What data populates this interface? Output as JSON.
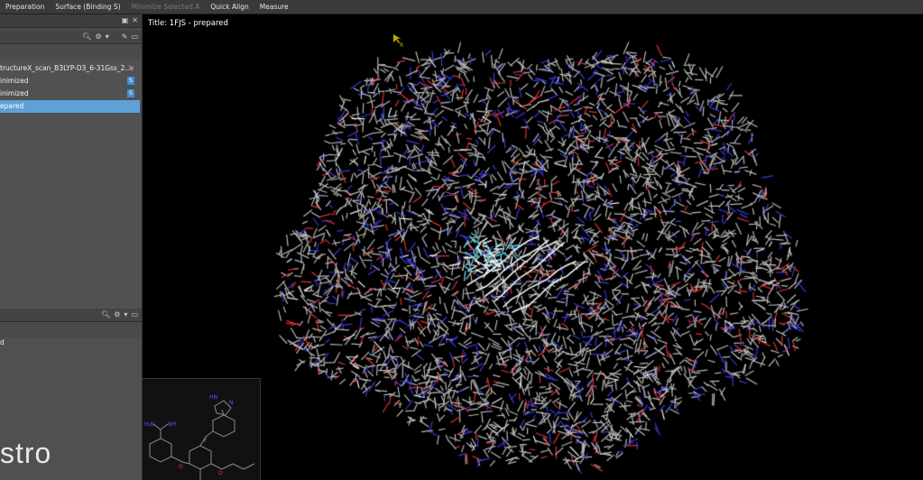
{
  "toolbar": {
    "items": [
      {
        "label": "Preparation",
        "enabled": true
      },
      {
        "label": "Surface (Binding S)",
        "enabled": true
      },
      {
        "label": "Minimize Selected A",
        "enabled": false
      },
      {
        "label": "Quick Align",
        "enabled": true
      },
      {
        "label": "Measure",
        "enabled": true
      }
    ]
  },
  "entries": {
    "row0": "tructureX_scan_B3LYP-D3_6-31Gss_2....",
    "row1": "inimized",
    "row2": "inimized",
    "row3": "epared",
    "badge1": "S",
    "badge2": "S"
  },
  "lower_panel": {
    "text": "d"
  },
  "watermark": "stro",
  "viewport": {
    "title": "Title: 1FJS - prepared"
  },
  "colors": {
    "carbon": "#b8b8b8",
    "nitrogen": "#3a3ae0",
    "oxygen": "#e03030",
    "highlight": "#5fd0e0",
    "selection": "#5fa0d6"
  }
}
